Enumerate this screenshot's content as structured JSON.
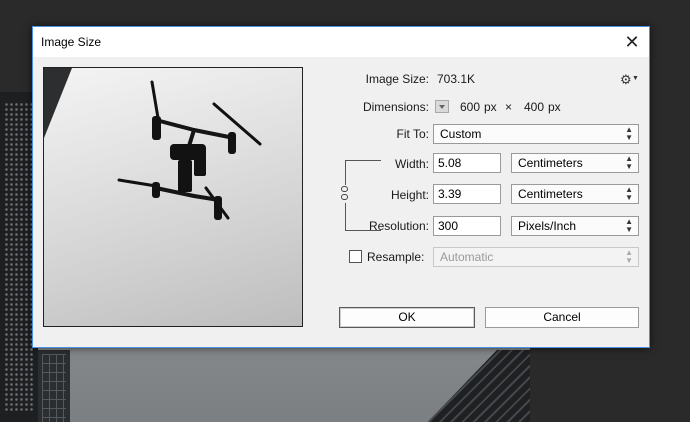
{
  "dialog": {
    "title": "Image Size",
    "close_symbol": "✕"
  },
  "image_size": {
    "label": "Image Size:",
    "value": "703.1K"
  },
  "dimensions": {
    "label": "Dimensions:",
    "width": "600",
    "width_unit": "px",
    "times": "×",
    "height": "400",
    "height_unit": "px"
  },
  "fit_to": {
    "label": "Fit To:",
    "value": "Custom"
  },
  "width": {
    "label": "Width:",
    "value": "5.08",
    "unit": "Centimeters"
  },
  "height": {
    "label": "Height:",
    "value": "3.39",
    "unit": "Centimeters"
  },
  "resolution": {
    "label": "Resolution:",
    "value": "300",
    "unit": "Pixels/Inch"
  },
  "resample": {
    "label": "Resample:",
    "checked": false,
    "method": "Automatic"
  },
  "buttons": {
    "ok": "OK",
    "cancel": "Cancel"
  },
  "icons": {
    "settings": "gear-icon",
    "link": "chain-link-icon",
    "close": "close-icon"
  },
  "colors": {
    "dialog_border": "#4a90e2",
    "dialog_bg": "#f0f0f0",
    "app_bg": "#2a2a2a"
  }
}
